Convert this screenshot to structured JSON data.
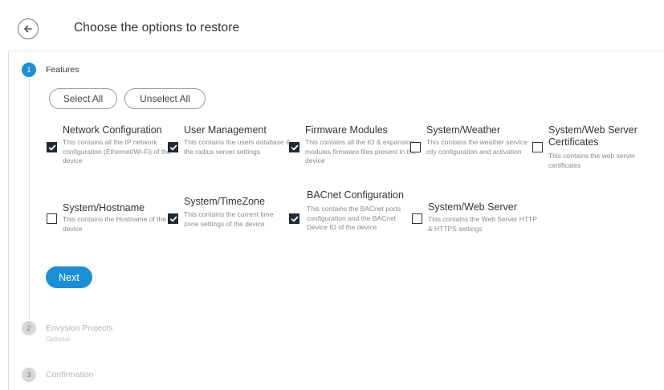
{
  "header": {
    "back_icon": "arrow-left-icon",
    "title": "Choose the options to restore"
  },
  "steps": [
    {
      "number": "1",
      "title": "Features",
      "subtitle": "",
      "state": "active"
    },
    {
      "number": "2",
      "title": "Envysion Projects",
      "subtitle": "Optional",
      "state": "inactive"
    },
    {
      "number": "3",
      "title": "Confirmation",
      "subtitle": "",
      "state": "inactive"
    }
  ],
  "actions": {
    "select_all": "Select All",
    "unselect_all": "Unselect All",
    "next": "Next"
  },
  "options": [
    {
      "title": "Network Configuration",
      "desc": "This contains all the IP network configuration (Ethernet/Wi-Fi) of the device",
      "checked": true
    },
    {
      "title": "User Management",
      "desc": "This contains the users database & the radius server settings",
      "checked": true
    },
    {
      "title": "Firmware Modules",
      "desc": "This contains all the IO & expansion modules firmware files present in the device",
      "checked": true
    },
    {
      "title": "System/Weather",
      "desc": "This contains the weather service city configuration and activation",
      "checked": false
    },
    {
      "title": "System/Web Server Certificates",
      "desc": "This contains the web server certificates",
      "checked": false
    },
    {
      "title": "System/Hostname",
      "desc": "This contains the Hostname of the device",
      "checked": false
    },
    {
      "title": "System/TimeZone",
      "desc": "This contains the current time zone settings of the device",
      "checked": true
    },
    {
      "title": "BACnet Configuration",
      "desc": "This contains the BACnet ports configuration and the BACnet Device ID of the device",
      "checked": true
    },
    {
      "title": "System/Web Server",
      "desc": "This contains the Web Server HTTP & HTTPS settings",
      "checked": false
    }
  ],
  "colors": {
    "accent": "#1b8fd6",
    "checkbox_checked": "#1f2a33",
    "inactive_text": "#b5b5b5"
  }
}
